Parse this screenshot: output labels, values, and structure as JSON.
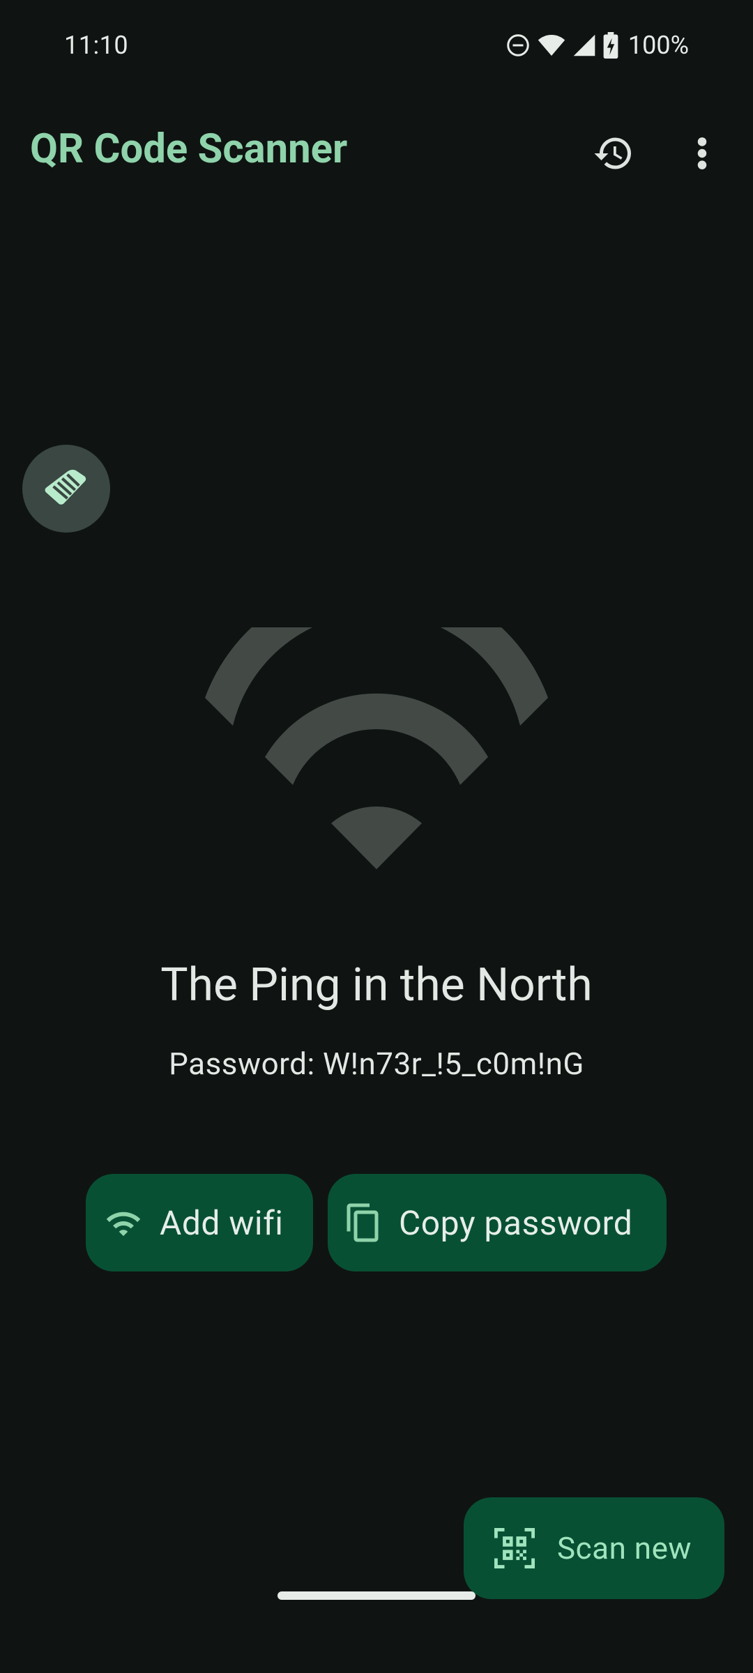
{
  "status_bar": {
    "time": "11:10",
    "battery": "100%"
  },
  "app_bar": {
    "title": "QR Code Scanner"
  },
  "result": {
    "network_name": "The Ping in the North",
    "password_line": "Password: W!n73r_!5_c0m!nG"
  },
  "actions": {
    "add_wifi": "Add wifi",
    "copy_password": "Copy password"
  },
  "fab": {
    "scan_new": "Scan new"
  },
  "colors": {
    "accent": "#8fd3ab",
    "button_bg": "#085034",
    "background": "#0f1412"
  }
}
